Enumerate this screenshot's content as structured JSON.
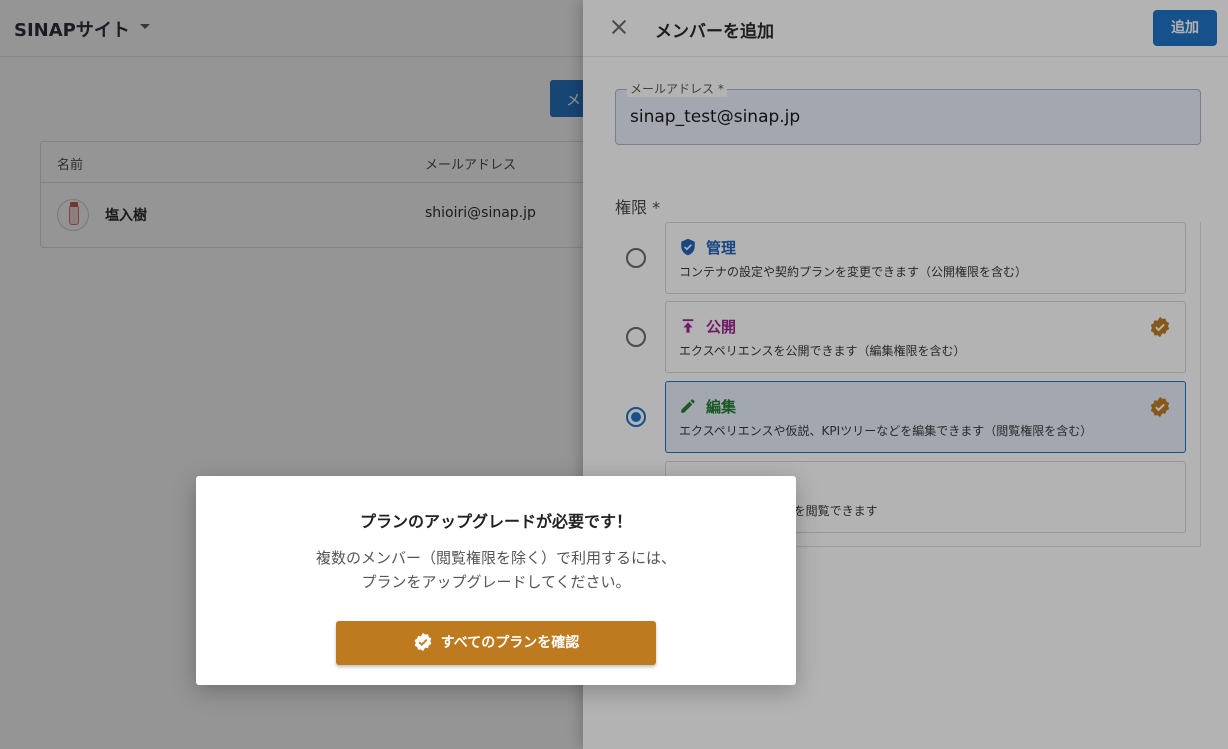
{
  "background": {
    "site_title": "SINAPサイト",
    "add_button_label": "メ",
    "table": {
      "headers": {
        "name": "名前",
        "email": "メールアドレス"
      },
      "rows": [
        {
          "name": "塩入樹",
          "email": "shioiri@sinap.jp"
        }
      ]
    }
  },
  "drawer": {
    "title": "メンバーを追加",
    "submit_label": "追加",
    "email_field": {
      "label": "メールアドレス *",
      "value": "sinap_test@sinap.jp"
    },
    "role_label": "権限 *",
    "roles": [
      {
        "title": "管理",
        "description": "コンテナの設定や契約プランを変更できます（公開権限を含む）",
        "color": "#1a5fb4",
        "icon": "shield-check-icon",
        "selected": false,
        "badge": false
      },
      {
        "title": "公開",
        "description": "エクスペリエンスを公開できます（編集権限を含む）",
        "color": "#9b1f8c",
        "icon": "publish-icon",
        "selected": false,
        "badge": true
      },
      {
        "title": "編集",
        "description": "エクスペリエンスや仮説、KPIツリーなどを編集できます（閲覧権限を含む）",
        "color": "#1f7a2e",
        "icon": "pencil-icon",
        "selected": true,
        "badge": true
      },
      {
        "title": "",
        "description": "仮説、KPIツリーなどを閲覧できます",
        "color": "#555555",
        "icon": "",
        "selected": false,
        "badge": false
      }
    ]
  },
  "modal": {
    "title": "プランのアップグレードが必要です！",
    "body_line1": "複数のメンバー（閲覧権限を除く）で利用するには、",
    "body_line2": "プランをアップグレードしてください。",
    "button_label": "すべてのプランを確認",
    "button_color": "#bd7a1e"
  },
  "colors": {
    "primary": "#1a6fc4",
    "premium_badge": "#bd7a1e"
  }
}
